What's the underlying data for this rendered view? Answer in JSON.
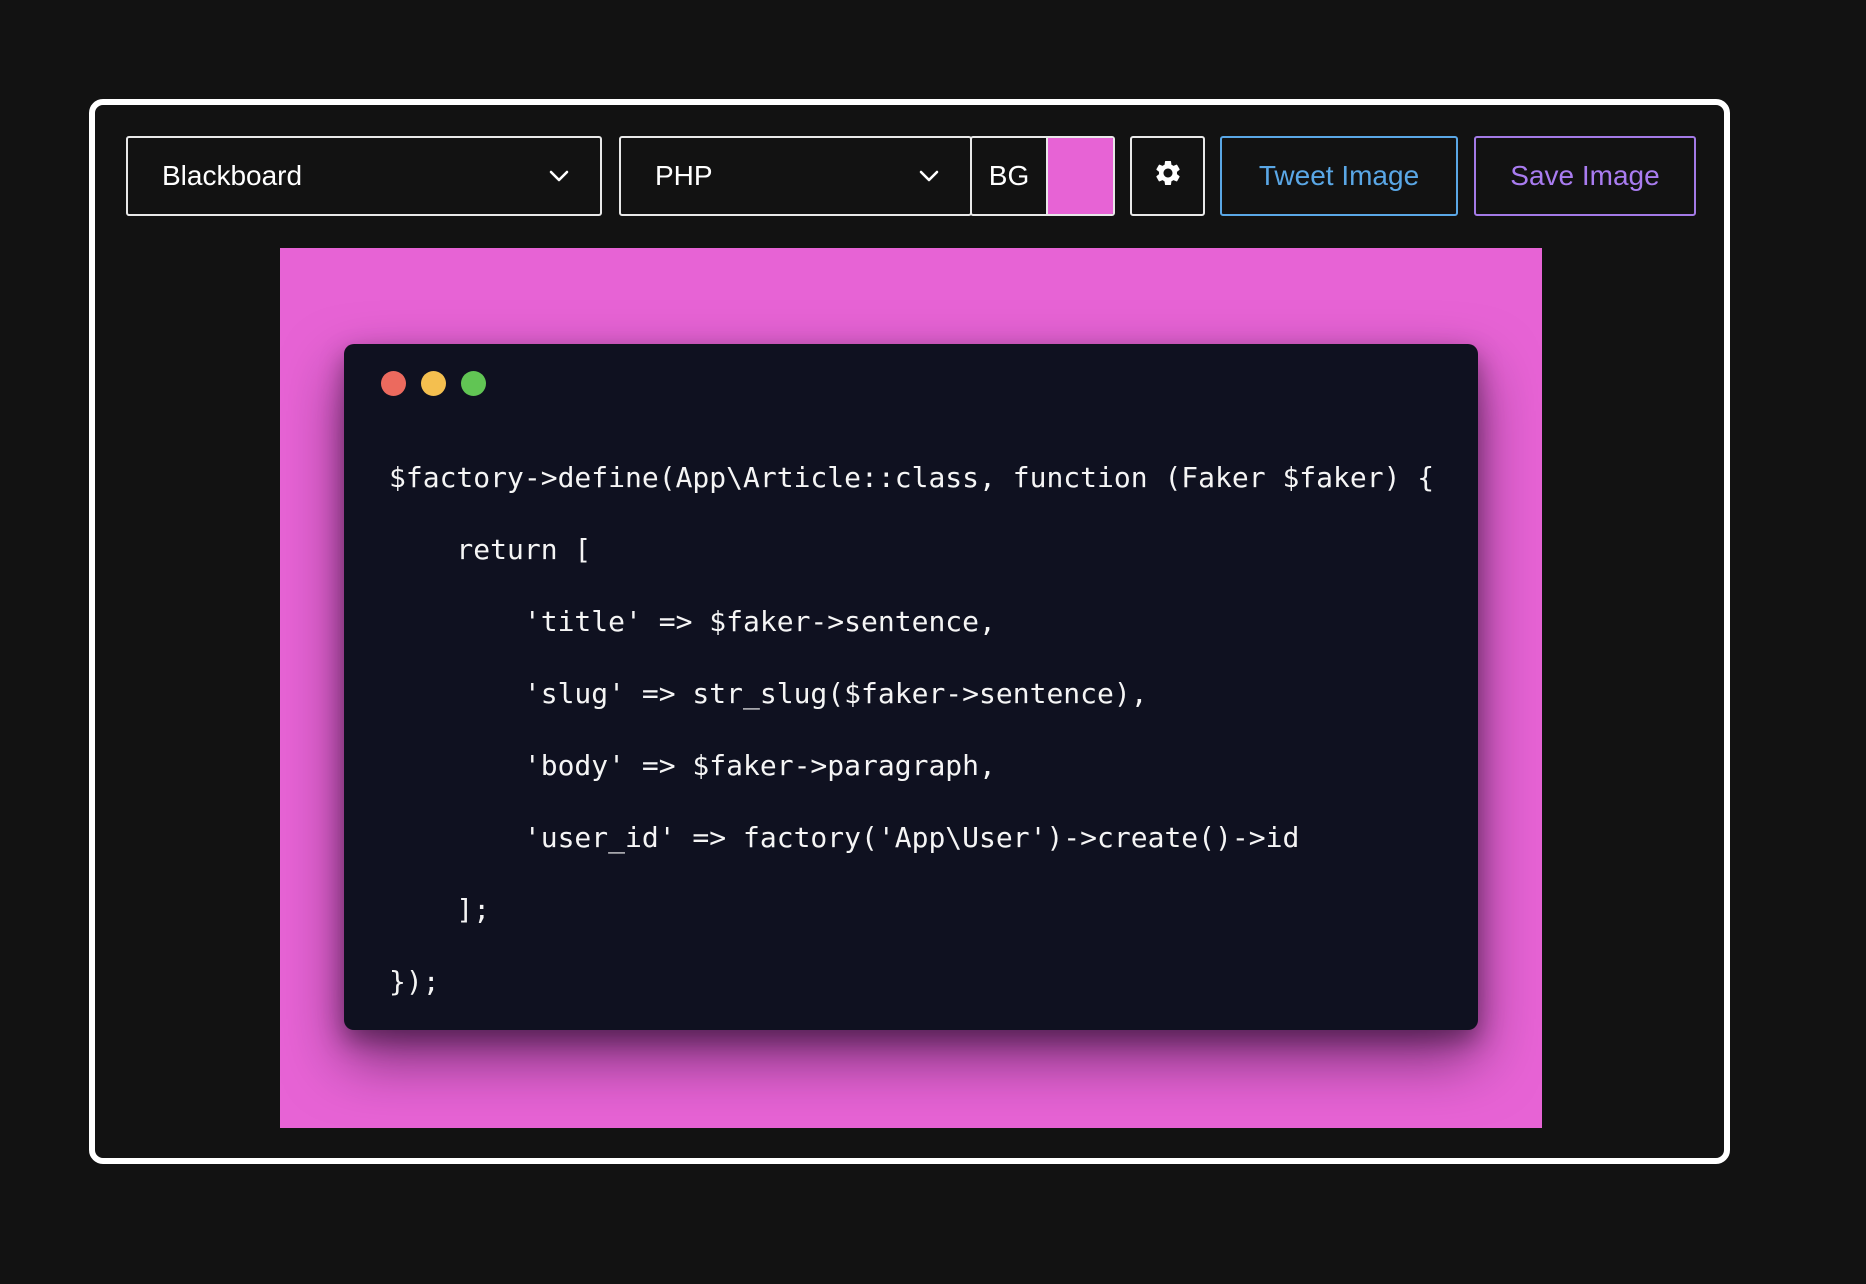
{
  "toolbar": {
    "theme_select": {
      "value": "Blackboard"
    },
    "language_select": {
      "value": "PHP"
    },
    "background": {
      "label": "BG",
      "color": "#e763d5"
    },
    "settings_icon": "gear-icon",
    "tweet_label": "Tweet Image",
    "save_label": "Save Image"
  },
  "colors": {
    "page_bg": "#121212",
    "frame_border": "#ffffff",
    "tweet_accent": "#5aa7e6",
    "save_accent": "#a97cf0",
    "canvas_bg": "#e763d5",
    "editor_bg": "#0f1120"
  },
  "editor": {
    "window_controls": [
      {
        "name": "close",
        "color": "#ec6a5e"
      },
      {
        "name": "minimize",
        "color": "#f4bf4f"
      },
      {
        "name": "zoom",
        "color": "#61c554"
      }
    ],
    "code_lines": [
      "$factory->define(App\\Article::class, function (Faker $faker) {",
      "    return [",
      "        'title' => $faker->sentence,",
      "        'slug' => str_slug($faker->sentence),",
      "        'body' => $faker->paragraph,",
      "        'user_id' => factory('App\\User')->create()->id",
      "    ];",
      "});"
    ]
  }
}
